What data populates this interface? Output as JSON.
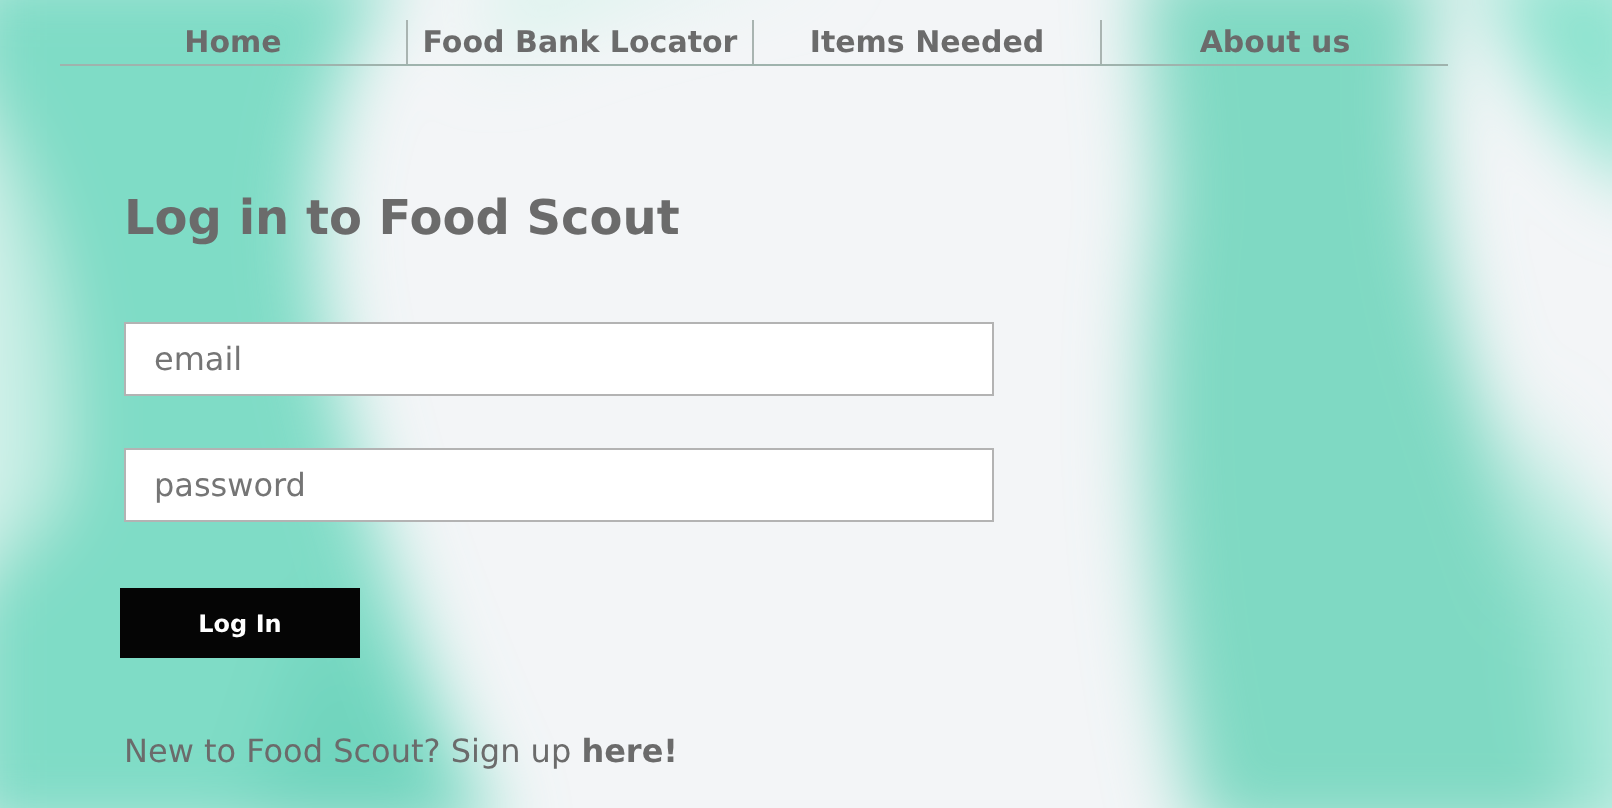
{
  "nav": [
    {
      "label": "Home"
    },
    {
      "label": "Food Bank Locator"
    },
    {
      "label": "Items Needed"
    },
    {
      "label": "About us"
    }
  ],
  "title": "Log in to Food Scout",
  "fields": [
    {
      "placeholder": "email"
    },
    {
      "placeholder": "password"
    }
  ],
  "button": "Log In",
  "signup": {
    "prompt": "New to Food Scout? Sign up",
    "link": "here!"
  }
}
